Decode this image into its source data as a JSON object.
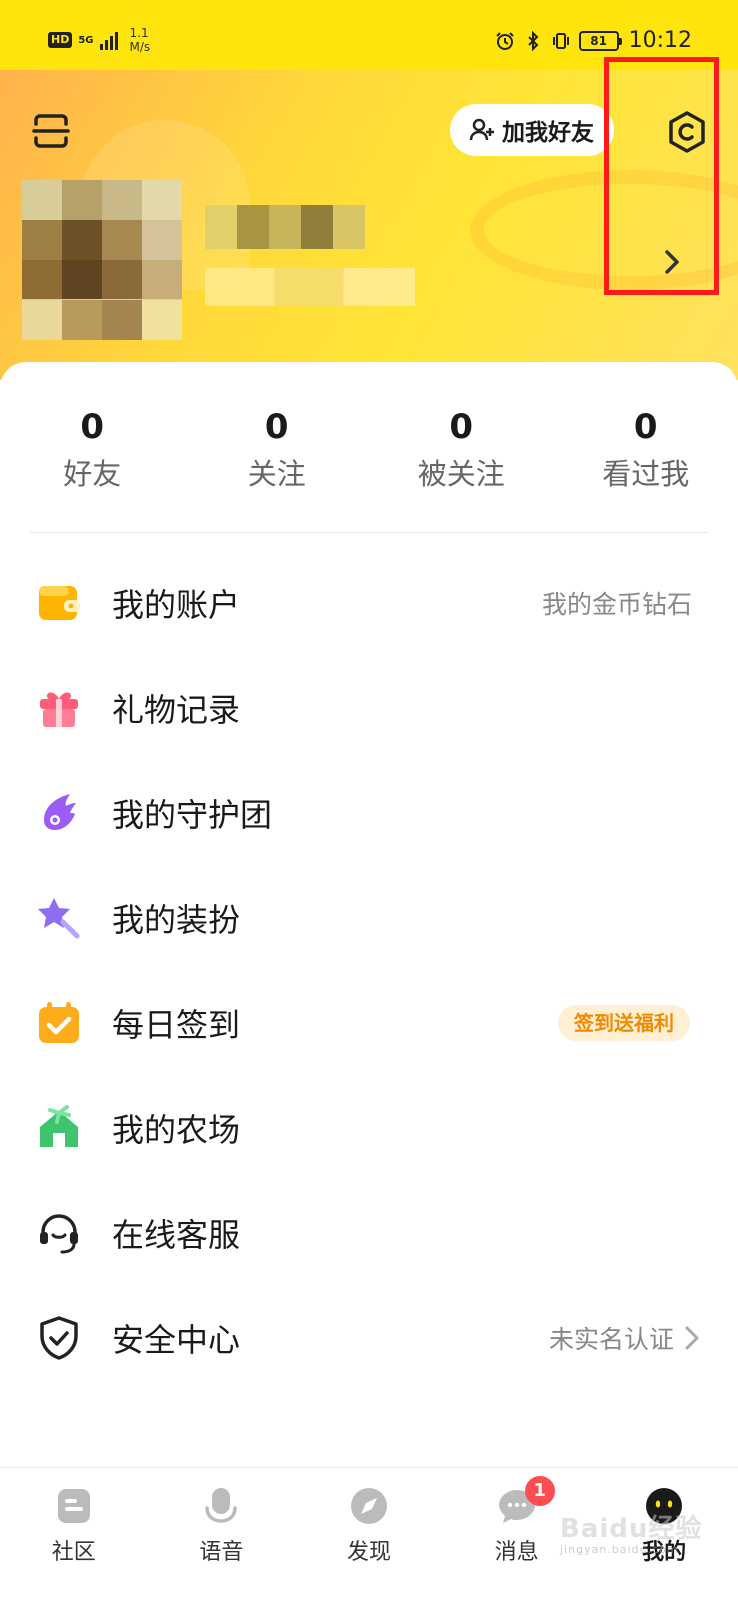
{
  "status_bar": {
    "hd": "HD",
    "network_gen": "5G",
    "speed_value": "1.1",
    "speed_unit": "M/s",
    "battery": "81",
    "time": "10:12"
  },
  "header": {
    "add_friend_label": "加我好友",
    "icons": {
      "scan": "scan-icon",
      "settings": "settings-hexagon-icon",
      "arrow": "chevron-right-icon"
    }
  },
  "stats": [
    {
      "value": "0",
      "label": "好友"
    },
    {
      "value": "0",
      "label": "关注"
    },
    {
      "value": "0",
      "label": "被关注"
    },
    {
      "value": "0",
      "label": "看过我"
    }
  ],
  "menu": [
    {
      "label": "我的账户",
      "right": "我的金币钻石",
      "icon": "wallet-icon"
    },
    {
      "label": "礼物记录",
      "icon": "gift-icon"
    },
    {
      "label": "我的守护团",
      "icon": "guard-wing-icon"
    },
    {
      "label": "我的装扮",
      "icon": "magic-wand-icon"
    },
    {
      "label": "每日签到",
      "badge": "签到送福利",
      "icon": "calendar-check-icon"
    },
    {
      "label": "我的农场",
      "icon": "farm-house-icon"
    },
    {
      "label": "在线客服",
      "icon": "headset-icon"
    },
    {
      "label": "安全中心",
      "right": "未实名认证",
      "icon": "shield-check-icon"
    }
  ],
  "bottom_nav": [
    {
      "label": "社区",
      "icon": "community-icon"
    },
    {
      "label": "语音",
      "icon": "microphone-icon"
    },
    {
      "label": "发现",
      "icon": "compass-icon"
    },
    {
      "label": "消息",
      "icon": "chat-icon",
      "badge": "1"
    },
    {
      "label": "我的",
      "icon": "profile-face-icon",
      "active": true
    }
  ],
  "watermark": {
    "brand": "Baidu经验",
    "url": "jingyan.baidu.com"
  },
  "colors": {
    "header_yellow": "#ffe50d",
    "highlight": "#ff1a1a",
    "badge_bg": "#fff0d4",
    "badge_text": "#f08a00",
    "unread": "#ff4d4f"
  }
}
